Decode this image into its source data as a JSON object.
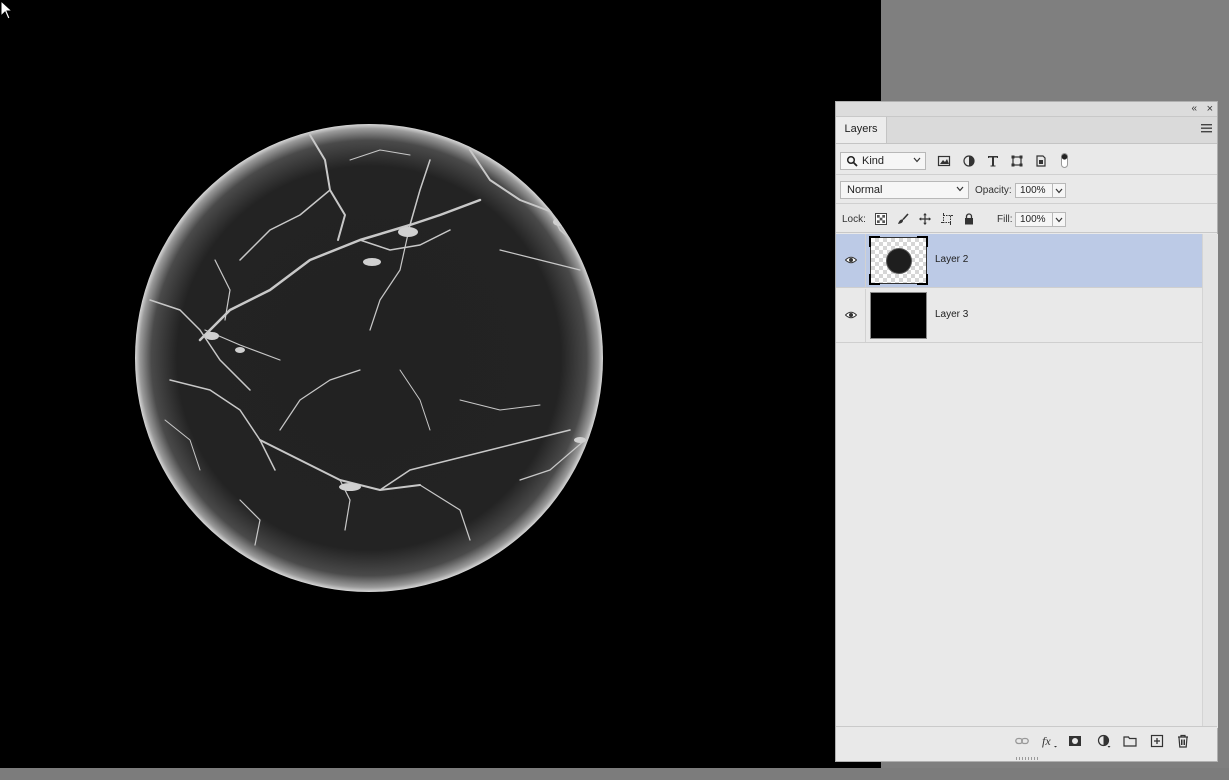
{
  "panel": {
    "tab_label": "Layers",
    "filter": {
      "kind_label": "Kind"
    },
    "blend_mode": "Normal",
    "opacity": {
      "label": "Opacity:",
      "value": "100%"
    },
    "lock": {
      "label": "Lock:"
    },
    "fill": {
      "label": "Fill:",
      "value": "100%"
    },
    "layers": [
      {
        "name": "Layer 2",
        "selected": true,
        "visible": true,
        "thumbnail": "planet-on-transparent"
      },
      {
        "name": "Layer 3",
        "selected": false,
        "visible": true,
        "thumbnail": "solid-black"
      }
    ]
  },
  "colors": {
    "canvas_background": "#000000",
    "workspace": "#7f7f7f",
    "panel_background": "#e9e9e9",
    "selected_row": "#bccae6"
  }
}
